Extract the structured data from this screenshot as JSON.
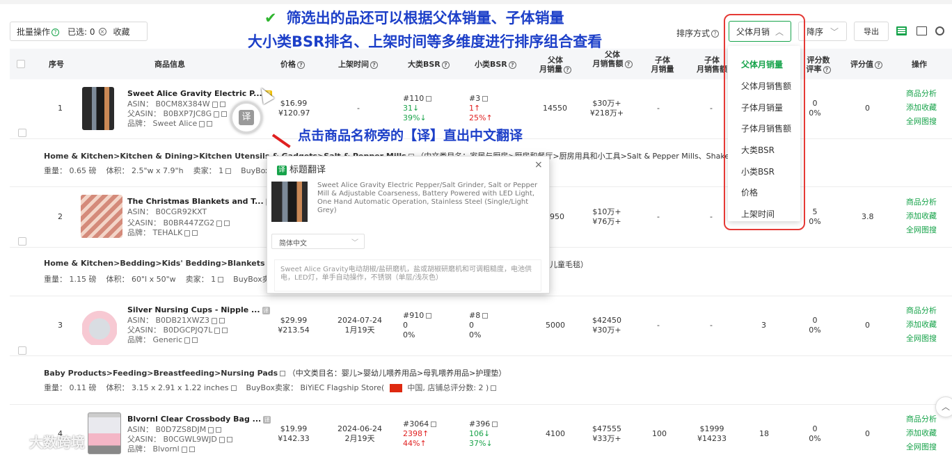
{
  "toolbar": {
    "batch_label": "批量操作",
    "selected_label": "已选:",
    "selected_count": "0",
    "favorite_label": "收藏",
    "sort_by_label": "排序方式",
    "sort_value": "父体月销",
    "order_value": "降序",
    "export_label": "导出"
  },
  "annotations": {
    "line1": "筛选出的品还可以根据父体销量、子体销量",
    "line2": "大小类BSR排名、上架时间等多维度进行排序组合查看",
    "translate_hint": "点击商品名称旁的【译】直出中文翻译",
    "check_mark": "✔"
  },
  "columns": {
    "index": "序号",
    "product": "商品信息",
    "price": "价格",
    "listed": "上架时间",
    "big_bsr": "大类BSR",
    "small_bsr": "小类BSR",
    "parent_sales_1": "父体",
    "parent_sales_2": "月销量",
    "parent_rev_1": "父体",
    "parent_rev_2": "月销售额",
    "child_sales_1": "子体",
    "child_sales_2": "月销量",
    "child_rev_1": "子体",
    "child_rev_2": "月销售额",
    "rating_count_1": "评分数",
    "rating_count_2": "评率",
    "rating": "评分值",
    "ops": "操作"
  },
  "sort_options": [
    "父体月销量",
    "父体月销售额",
    "子体月销量",
    "子体月销售额",
    "大类BSR",
    "小类BSR",
    "价格",
    "上架时间"
  ],
  "ops_labels": [
    "商品分析",
    "添加收藏",
    "全网图搜"
  ],
  "rows": [
    {
      "index": "1",
      "title": "Sweet Alice Gravity Electric P...",
      "asin": "ASIN： B0CM8X384W",
      "parent_asin": "父ASIN： B0BXP7JC8G",
      "brand": "品牌： Sweet Alice",
      "price_usd": "$16.99",
      "price_cny": "¥120.97",
      "listed": "-",
      "listed_ago": "",
      "big_bsr": "#110",
      "big_bsr_change": "31↓",
      "big_bsr_pct": "39%↓",
      "small_bsr": "#3",
      "small_bsr_change": "1↑",
      "small_bsr_pct": "25%↑",
      "parent_sales": "14550",
      "parent_rev_1": "$30万+",
      "parent_rev_2": "¥218万+",
      "child_sales": "-",
      "child_rev_1": "-",
      "child_rev_2": "",
      "rating_count": "0",
      "rating_rate": "0%",
      "rating": "0",
      "category": "Home & Kitchen>Kitchen & Dining>Kitchen Utensils & Gadgets>Salt & Pepper Mills",
      "category_cn": "（中文类目名：家居与厨房>厨房和餐厅>厨房用具和小工具>Salt & Pepper Mills、Shakers 和",
      "weight": "重量： 0.65 磅",
      "volume": "体积： 2.5\"w x 7.9\"h",
      "seller": "卖家：",
      "seller_val": "1",
      "buybox": "BuyBox卖"
    },
    {
      "index": "2",
      "title": "The Christmas Blankets and T...",
      "asin": "ASIN： B0CGR92KXT",
      "parent_asin": "父ASIN： B0BR447ZG2",
      "brand": "品牌： TEHALK",
      "price_usd": "",
      "price_cny": "",
      "listed": "",
      "listed_ago": "",
      "big_bsr": "",
      "big_bsr_change": "",
      "big_bsr_pct": "",
      "small_bsr": "",
      "small_bsr_change": "",
      "small_bsr_pct": "",
      "parent_sales": "950",
      "parent_rev_1": "$10万+",
      "parent_rev_2": "¥76万+",
      "child_sales": "-",
      "child_rev_1": "-",
      "child_rev_2": "",
      "rating_count": "5",
      "rating_rate": "0%",
      "rating": "3.8",
      "category": "Home & Kitchen>Bedding>Kids' Bedding>Blankets & Thro",
      "category_cn": "儿童毛毯）",
      "weight": "重量： 1.15 磅",
      "volume": "体积： 60\"l x 50\"w",
      "seller": "卖家：",
      "seller_val": "1",
      "buybox": "BuyBox卖"
    },
    {
      "index": "3",
      "title": "Silver Nursing Cups - Nipple ...",
      "asin": "ASIN： B0DB21XWZ3",
      "parent_asin": "父ASIN： B0DGCPJQ7L",
      "brand": "品牌： Generic",
      "price_usd": "$29.99",
      "price_cny": "¥213.54",
      "listed": "2024-07-24",
      "listed_ago": "1月19天",
      "big_bsr": "#910",
      "big_bsr_change": "0",
      "big_bsr_pct": "0%",
      "small_bsr": "#8",
      "small_bsr_change": "0",
      "small_bsr_pct": "0%",
      "parent_sales": "5000",
      "parent_rev_1": "$42450",
      "parent_rev_2": "¥30万+",
      "child_sales": "-",
      "child_rev_1": "-",
      "child_rev_2": "",
      "child_extra": "3",
      "rating_count": "0",
      "rating_rate": "0%",
      "rating": "0",
      "category": "Baby Products>Feeding>Breastfeeding>Nursing Pads",
      "category_cn": "（中文类目名：婴儿>婴幼儿喂养用品>母乳喂养用品>护理垫）",
      "weight": "重量： 0.11 磅",
      "volume": "体积： 3.15 x 2.91 x 1.22 inches",
      "seller": "卖家：",
      "seller_val": "1",
      "buybox": "BuyBox卖家： BiYiEC Flagship Store(",
      "buybox_tail": "中国, 店铺总评分数: 2 )"
    },
    {
      "index": "4",
      "title": "Blvornl Clear Crossbody Bag ...",
      "asin": "ASIN： B0D7ZS8DJM",
      "parent_asin": "父ASIN： B0CGWL9WJD",
      "brand": "品牌： Blvornl",
      "price_usd": "$19.99",
      "price_cny": "¥142.33",
      "listed": "2024-06-24",
      "listed_ago": "2月19天",
      "big_bsr": "#3064",
      "big_bsr_change": "2398↑",
      "big_bsr_pct": "44%↑",
      "small_bsr": "#396",
      "small_bsr_change": "106↓",
      "small_bsr_pct": "37%↓",
      "parent_sales": "4100",
      "parent_rev_1": "$47555",
      "parent_rev_2": "¥33万+",
      "child_sales": "100",
      "child_rev_1": "$1999",
      "child_rev_2": "¥14233",
      "child_extra": "18",
      "rating_count": "0",
      "rating_rate": "0%",
      "rating": "0"
    }
  ],
  "popup": {
    "title": "标题翻译",
    "badge": "译",
    "close": "×",
    "english": "Sweet Alice Gravity Electric Pepper/Salt Grinder, Salt or Pepper Mill & Adjustable Coarseness, Battery Powered with LED Light, One Hand Automatic Operation, Stainless Steel (Single/Light Grey)",
    "language": "简体中文",
    "chinese": "Sweet Alice Gravity电动胡椒/盐研磨机，盐或胡椒研磨机和可调粗糙度，电池供电，LED灯，单手自动操作，不锈钢（单层/浅灰色）"
  },
  "watermark": "大数跨境",
  "yi_label": "译"
}
